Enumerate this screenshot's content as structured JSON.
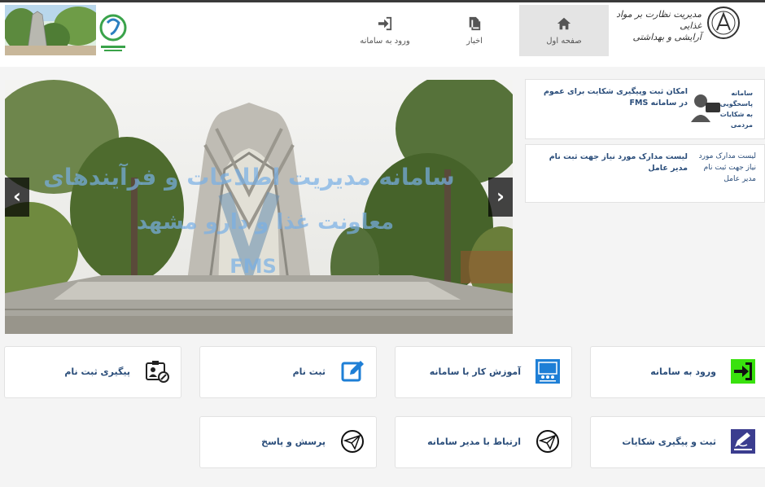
{
  "header": {
    "brand_line1": "مدیریت نظارت بر مواد غذایی",
    "brand_line2": "آرایشی و بهداشتی",
    "nav": [
      {
        "label": "صفحه اول",
        "icon": "home-icon",
        "active": true
      },
      {
        "label": "اخبار",
        "icon": "news-icon",
        "active": false
      },
      {
        "label": "ورود به سامانه",
        "icon": "login-icon",
        "active": false
      }
    ]
  },
  "carousel": {
    "caption_line1": "سامانه مدیریت اطلاعات و فرآیندهای",
    "caption_line2": "معاونت غذا و دارو مشهد",
    "caption_line3": "FMS",
    "prev_label": "‹",
    "next_label": "›"
  },
  "news": [
    {
      "title": "امکان ثبت وپیگیری شکایت برای عموم در سامانه FMS",
      "thumb_text": "سامانه پاسخگویی به شکایات مردمی"
    },
    {
      "title": "لیست مدارک مورد نیاز جهت ثبت نام مدیر عامل",
      "thumb_text": "لیست مدارک مورد نیاز جهت ثبت نام مدیر عامل"
    }
  ],
  "tiles": [
    {
      "label": "ورود به سامانه",
      "icon": "login-arrow-icon"
    },
    {
      "label": "آموزش کار با سامانه",
      "icon": "training-icon"
    },
    {
      "label": "ثبت نام",
      "icon": "edit-icon"
    },
    {
      "label": "پیگیری ثبت نام",
      "icon": "id-card-icon"
    },
    {
      "label": "ثبت و پیگیری شکایات",
      "icon": "complaint-icon"
    },
    {
      "label": "ارتباط با مدیر سامانه",
      "icon": "paper-plane-icon"
    },
    {
      "label": "پرسش و پاسخ",
      "icon": "qa-icon"
    }
  ],
  "colors": {
    "link": "#2a4d7a",
    "accent_green": "#39e10e",
    "accent_blue": "#1e7fd6",
    "accent_purple": "#3b3d8f"
  }
}
